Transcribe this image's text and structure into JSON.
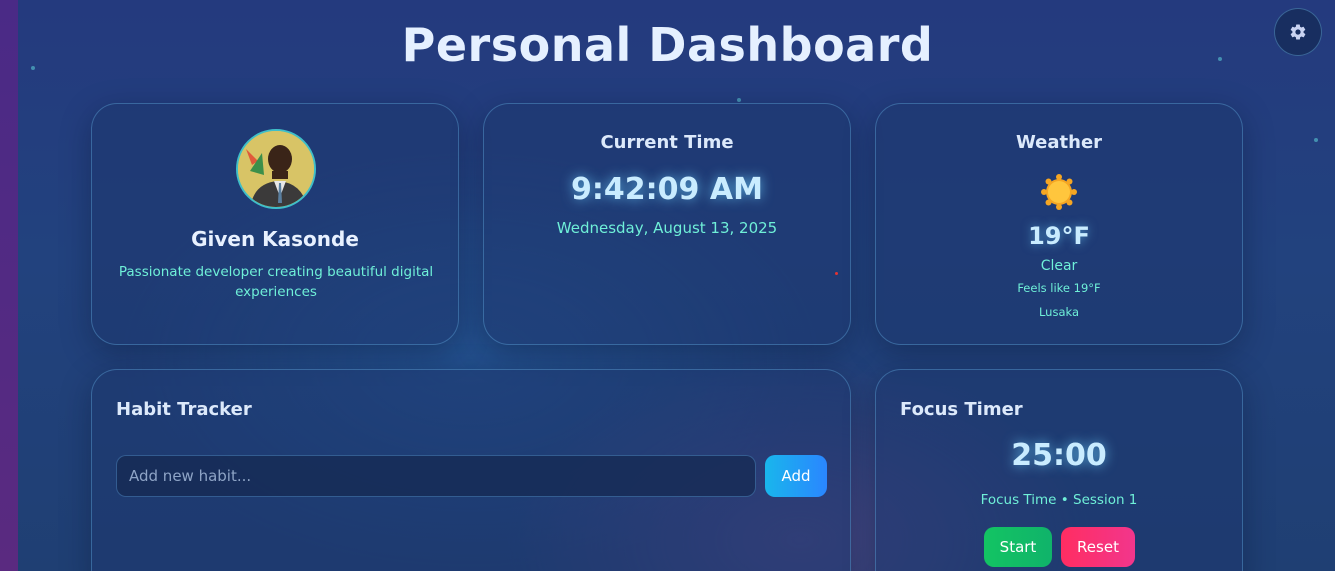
{
  "page": {
    "title": "Personal Dashboard"
  },
  "settings": {
    "icon": "gear-icon"
  },
  "profile": {
    "name": "Given Kasonde",
    "bio": "Passionate developer creating beautiful digital experiences"
  },
  "time": {
    "heading": "Current Time",
    "clock": "9:42:09 AM",
    "date": "Wednesday, August 13, 2025"
  },
  "weather": {
    "heading": "Weather",
    "icon": "sun-icon",
    "temperature": "19°F",
    "condition": "Clear",
    "feels_like": "Feels like 19°F",
    "location": "Lusaka"
  },
  "habits": {
    "heading": "Habit Tracker",
    "input_placeholder": "Add new habit...",
    "add_label": "Add"
  },
  "focus": {
    "heading": "Focus Timer",
    "timer": "25:00",
    "session": "Focus Time • Session 1",
    "start_label": "Start",
    "reset_label": "Reset"
  },
  "colors": {
    "accent_teal": "#6ff0d8",
    "add_button": "#2a86ff",
    "start_button": "#13c463",
    "reset_button": "#ff2d62"
  }
}
